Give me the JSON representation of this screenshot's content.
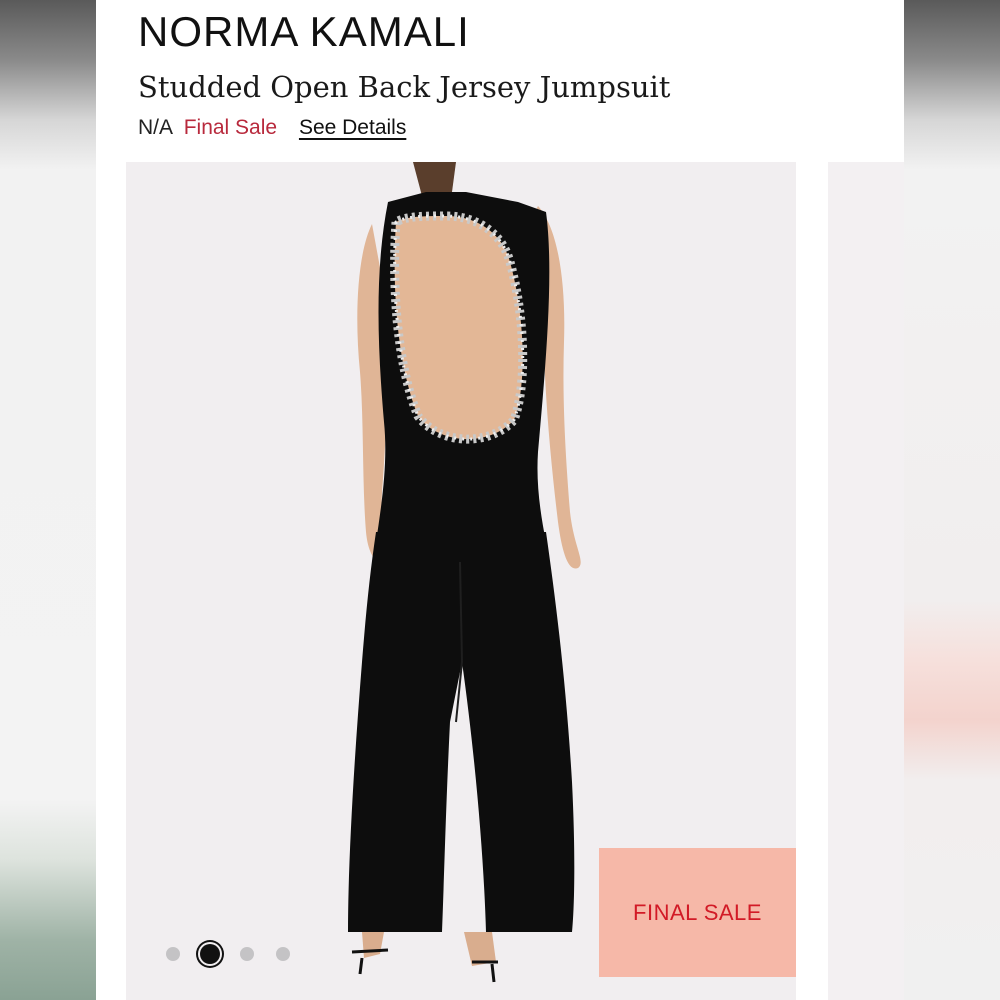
{
  "product": {
    "brand": "NORMA KAMALI",
    "title": "Studded Open Back Jersey Jumpsuit",
    "price": "N/A",
    "sale_label": "Final Sale",
    "details_link": "See Details"
  },
  "gallery": {
    "badge": "FINAL SALE",
    "dots": [
      {
        "active": false
      },
      {
        "active": true
      },
      {
        "active": false
      },
      {
        "active": false
      }
    ]
  },
  "colors": {
    "sale_text": "#b8293c",
    "badge_bg": "#f6b8a8",
    "badge_text": "#d21a26",
    "image_bg": "#f1eef0"
  }
}
